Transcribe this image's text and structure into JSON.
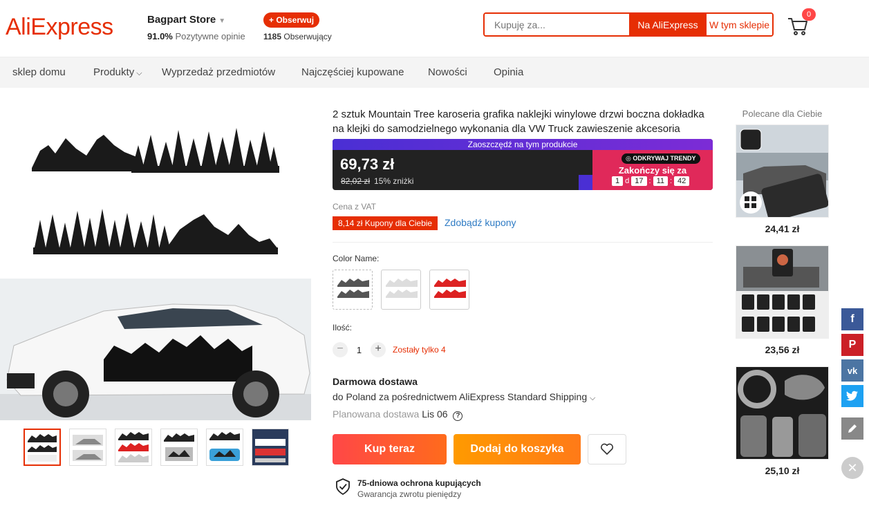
{
  "header": {
    "logo": "AliExpress",
    "store_name": "Bagpart Store",
    "rating_pct": "91.0%",
    "rating_label": "Pozytywne opinie",
    "follow_label": "+ Obserwuj",
    "followers_count": "1185",
    "followers_label": "Obserwujący",
    "search_placeholder": "Kupuję za...",
    "search_aliexpress": "Na AliExpress",
    "search_store": "W tym sklepie",
    "cart_count": "0"
  },
  "nav": {
    "items": [
      "sklep domu",
      "Produkty",
      "Wyprzedaż przedmiotów",
      "Najczęściej kupowane",
      "Nowości",
      "Opinia"
    ]
  },
  "product": {
    "title": "2 sztuk Mountain Tree karoseria grafika naklejki winylowe drzwi boczna dokładka na klejki do samodzielnego wykonania dla VW Truck zawieszenie akcesoria dekoracyjne",
    "save_banner": "Zaoszczędź na tym produkcie",
    "price": "69,73 zł",
    "old_price": "82,02 zł",
    "discount": "15% zniżki",
    "trendy_label": "ODKRYWAJ TRENDY",
    "ends_label": "Zakończy się za",
    "timer": {
      "days": "1",
      "d": "d",
      "hours": "17",
      "minutes": "11",
      "seconds": "42"
    },
    "vat": "Cena z VAT",
    "coupon": "8,14 zł Kupony dla Ciebie",
    "coupon_link": "Zdobądź kupony",
    "color_label": "Color Name:",
    "qty_label": "Ilość:",
    "qty_value": "1",
    "qty_left": "Zostały tylko 4",
    "shipping_title": "Darmowa dostawa",
    "shipping_desc": "do Poland za pośrednictwem AliExpress Standard Shipping",
    "delivery_label": "Planowana dostawa",
    "delivery_date": "Lis 06",
    "buy_now": "Kup teraz",
    "add_to_cart": "Dodaj do koszyka",
    "protection_title": "75-dniowa ochrona kupujących",
    "protection_sub": "Gwarancja zwrotu pieniędzy"
  },
  "recommended": {
    "title": "Polecane dla Ciebie",
    "prices": [
      "24,41 zł",
      "23,56 zł",
      "25,10 zł"
    ]
  },
  "colors": {
    "brand": "#e62e04",
    "buy": "#ff4747",
    "cart": "#ff9a00",
    "link": "#2e7bc4"
  }
}
